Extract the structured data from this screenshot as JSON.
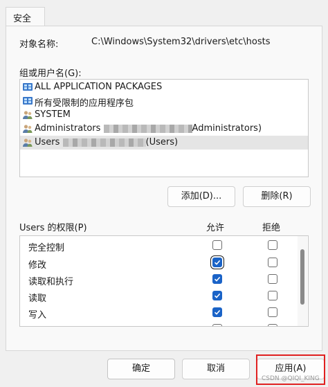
{
  "tab": {
    "label": "安全"
  },
  "object": {
    "label": "对象名称:",
    "value": "C:\\Windows\\System32\\drivers\\etc\\hosts"
  },
  "groups": {
    "label": "组或用户名(G):",
    "items": [
      {
        "label": "ALL APPLICATION PACKAGES",
        "icon": "app-packages-icon"
      },
      {
        "label": "所有受限制的应用程序包",
        "icon": "app-packages-icon"
      },
      {
        "label": "SYSTEM",
        "icon": "users-icon"
      },
      {
        "label": "Administrators",
        "suffix": "Administrators)",
        "icon": "users-icon"
      },
      {
        "label": "Users",
        "suffix": "(Users)",
        "icon": "users-icon",
        "selected": true
      }
    ]
  },
  "buttons": {
    "add": "添加(D)...",
    "remove": "删除(R)",
    "ok": "确定",
    "cancel": "取消",
    "apply": "应用(A)"
  },
  "permissions": {
    "label": "Users 的权限(P)",
    "allow_header": "允许",
    "deny_header": "拒绝",
    "rows": [
      {
        "label": "完全控制",
        "allow": false,
        "deny": false
      },
      {
        "label": "修改",
        "allow": true,
        "deny": false
      },
      {
        "label": "读取和执行",
        "allow": true,
        "deny": false
      },
      {
        "label": "读取",
        "allow": true,
        "deny": false
      },
      {
        "label": "写入",
        "allow": true,
        "deny": false
      }
    ]
  },
  "watermark": "CSDN @QIQI_KING",
  "colors": {
    "accent": "#1a63c7",
    "highlight": "#e02020"
  }
}
